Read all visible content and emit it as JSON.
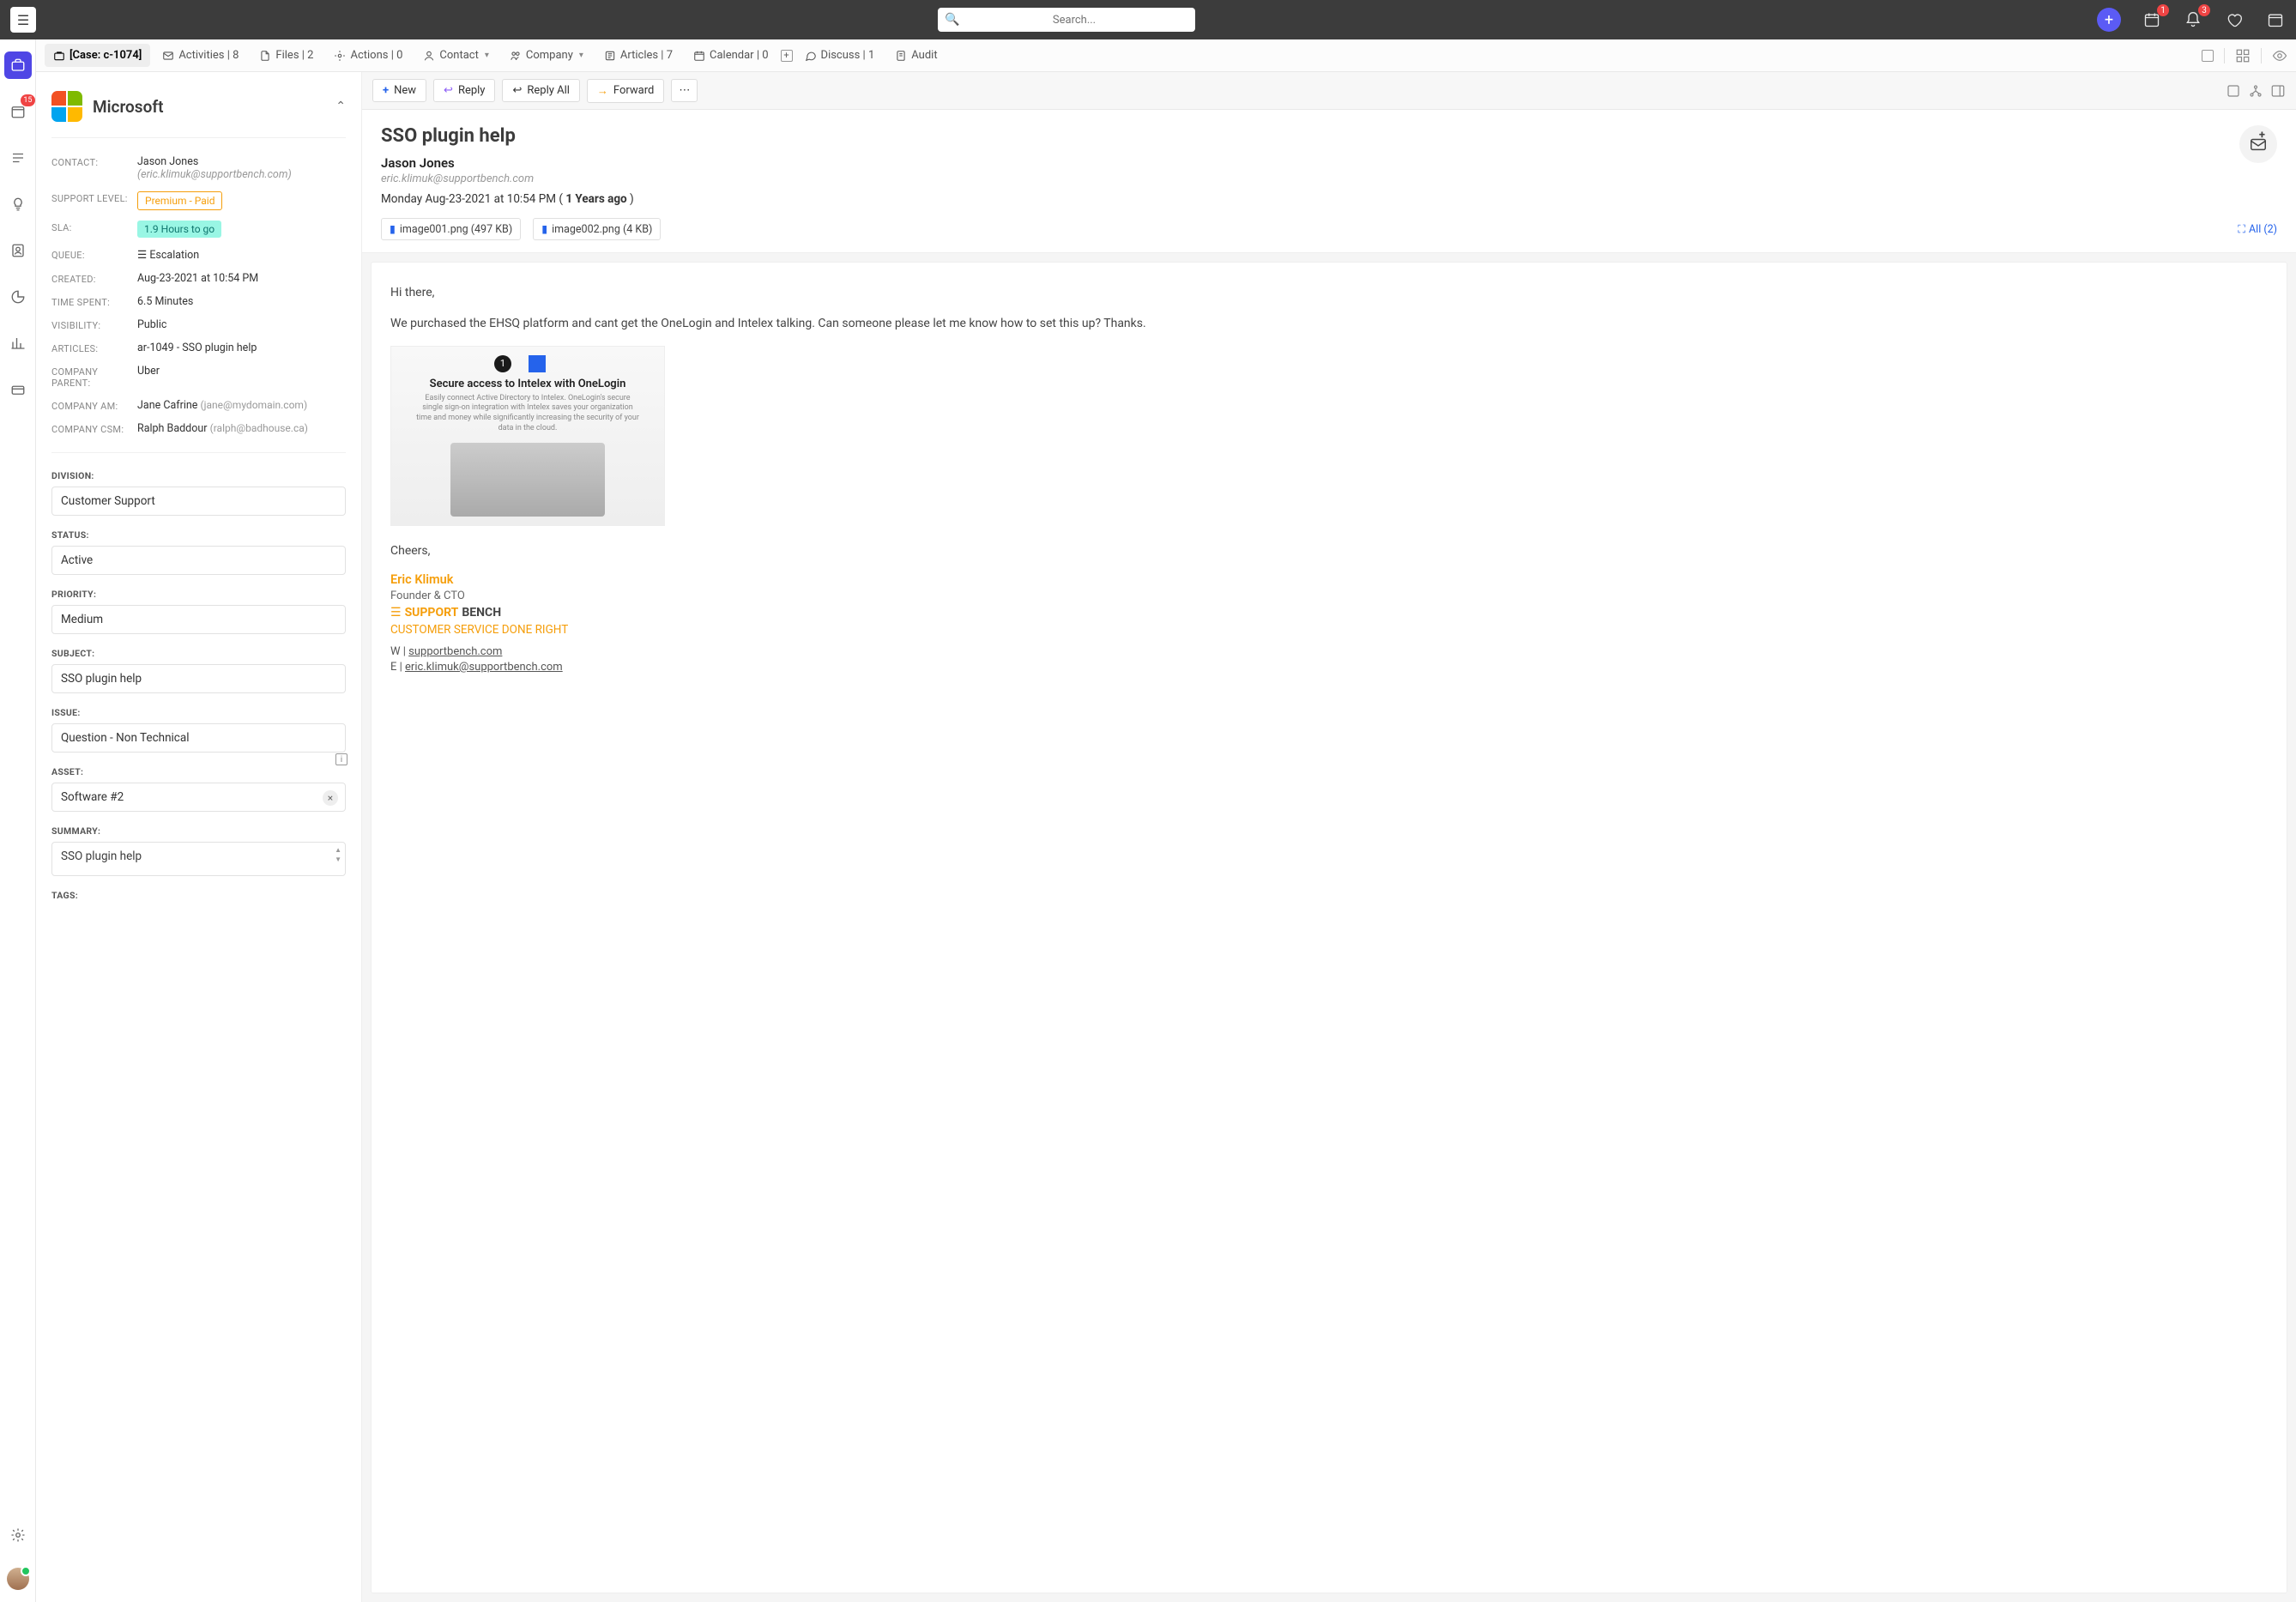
{
  "topbar": {
    "search_placeholder": "Search...",
    "cal_badge": "1",
    "bell_badge": "3"
  },
  "leftrail": {
    "case_badge": "15"
  },
  "tabs": {
    "case": "[Case: c-1074]",
    "activities": "Activities | 8",
    "files": "Files | 2",
    "actions": "Actions | 0",
    "contact": "Contact",
    "company": "Company",
    "articles": "Articles | 7",
    "calendar": "Calendar | 0",
    "discuss": "Discuss | 1",
    "audit": "Audit"
  },
  "details": {
    "company_name": "Microsoft",
    "contact_label": "CONTACT:",
    "contact_name": "Jason Jones",
    "contact_sub": "(eric.klimuk@supportbench.com)",
    "level_label": "SUPPORT LEVEL:",
    "level_value": "Premium - Paid",
    "sla_label": "SLA:",
    "sla_value": "1.9 Hours to go",
    "queue_label": "QUEUE:",
    "queue_value": "Escalation",
    "created_label": "CREATED:",
    "created_value": "Aug-23-2021 at 10:54 PM",
    "time_label": "TIME SPENT:",
    "time_value": "6.5 Minutes",
    "vis_label": "VISIBILITY:",
    "vis_value": "Public",
    "art_label": "ARTICLES:",
    "art_value": "ar-1049 - SSO plugin help",
    "parent_label": "COMPANY PARENT:",
    "parent_value": "Uber",
    "am_label": "COMPANY AM:",
    "am_name": "Jane Cafrine",
    "am_sub": "(jane@mydomain.com)",
    "csm_label": "COMPANY CSM:",
    "csm_name": "Ralph Baddour",
    "csm_sub": "(ralph@badhouse.ca)",
    "division_label": "DIVISION:",
    "division_value": "Customer Support",
    "status_label": "STATUS:",
    "status_value": "Active",
    "priority_label": "PRIORITY:",
    "priority_value": "Medium",
    "subject_label": "SUBJECT:",
    "subject_value": "SSO plugin help",
    "issue_label": "ISSUE:",
    "issue_value": "Question - Non Technical",
    "asset_label": "ASSET:",
    "asset_value": "Software #2",
    "summary_label": "SUMMARY:",
    "summary_value": "SSO plugin help",
    "tags_label": "TAGS:"
  },
  "toolbar": {
    "new": "New",
    "reply": "Reply",
    "replyall": "Reply All",
    "forward": "Forward"
  },
  "message": {
    "subject": "SSO plugin help",
    "from_name": "Jason Jones",
    "from_email": "eric.klimuk@supportbench.com",
    "date_pre": "Monday Aug-23-2021 at 10:54 PM ( ",
    "date_ago": "1 Years ago",
    "date_post": " )",
    "att1": "image001.png (497 KB)",
    "att2": "image002.png (4 KB)",
    "all": "All (2)",
    "body_greet": "Hi there,",
    "body_main": "We purchased the EHSQ platform and cant get the OneLogin and Intelex talking.  Can someone please let me know how to set this up? Thanks.",
    "img_title": "Secure access to Intelex with OneLogin",
    "img_sub": "Easily connect Active Directory to Intelex. OneLogin's secure single sign-on integration with Intelex saves your organization time and money while significantly increasing the security of your data in the cloud.",
    "cheers": "Cheers,",
    "sig_name": "Eric Klimuk",
    "sig_title": "Founder & CTO",
    "sb1": "SUPPORT",
    "sb2": "BENCH",
    "tagline": "CUSTOMER SERVICE DONE RIGHT",
    "w_pre": "W | ",
    "w_link": "supportbench.com",
    "e_pre": "E | ",
    "e_link": "eric.klimuk@supportbench.com"
  }
}
